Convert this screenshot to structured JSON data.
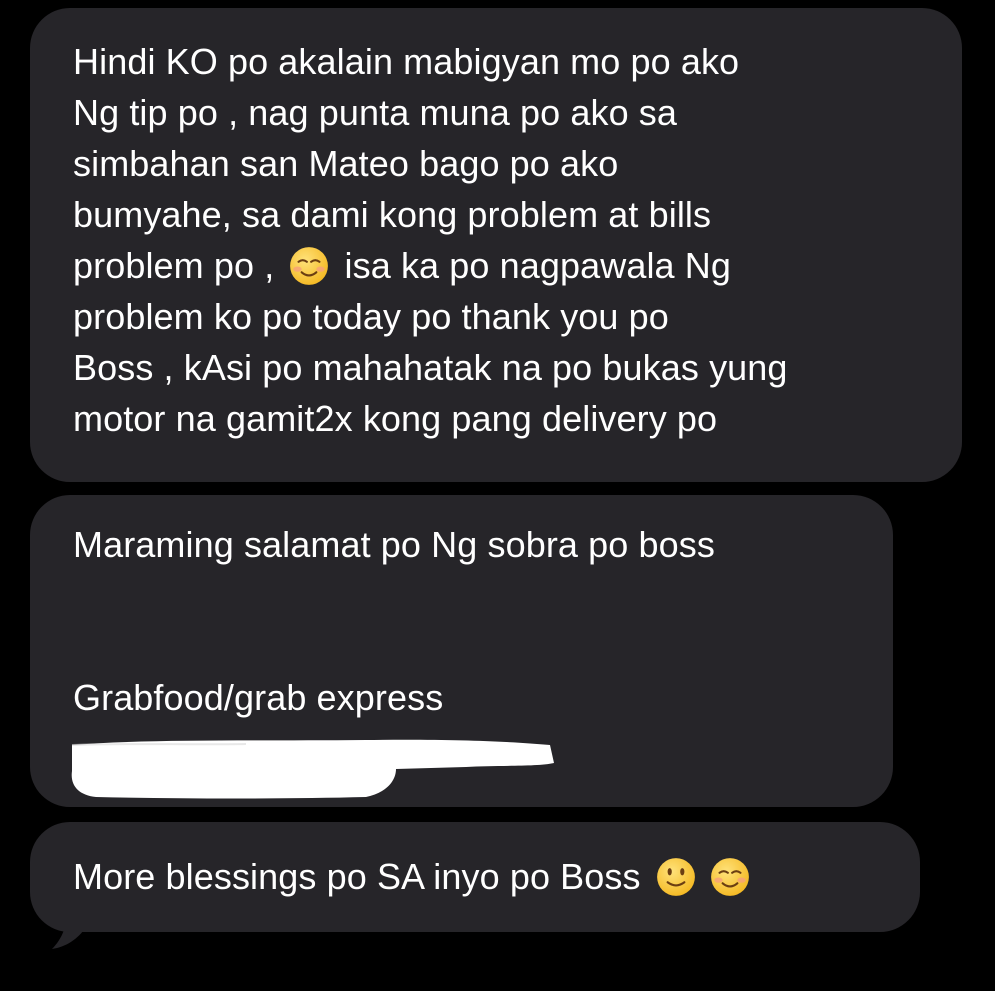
{
  "conversation": {
    "messages": [
      {
        "lines": [
          "Hindi KO po akalain mabigyan mo po ako",
          "Ng tip po , nag punta muna po ako sa",
          "simbahan san Mateo bago po ako",
          "bumyahe, sa dami kong problem at bills",
          "problem po ,",
          "isa ka po nagpawala Ng",
          "problem ko po today po thank you po",
          "Boss , kAsi po mahahatak na po bukas yung",
          "motor na gamit2x kong pang delivery po"
        ],
        "inline_emoji": "smiling-face-icon"
      },
      {
        "lines": [
          "Maraming salamat po Ng sobra po boss",
          "Grabfood/grab express"
        ],
        "redacted_line": "redacted-text"
      },
      {
        "lines": [
          "More blessings po SA inyo po Boss"
        ],
        "trailing_emojis": [
          "slightly-smiling-face-icon",
          "smiling-face-icon"
        ]
      }
    ]
  },
  "colors": {
    "background": "#000000",
    "bubble": "#262529",
    "text": "#ffffff",
    "emoji_yellow": "#f8c233",
    "redaction": "#ffffff"
  }
}
